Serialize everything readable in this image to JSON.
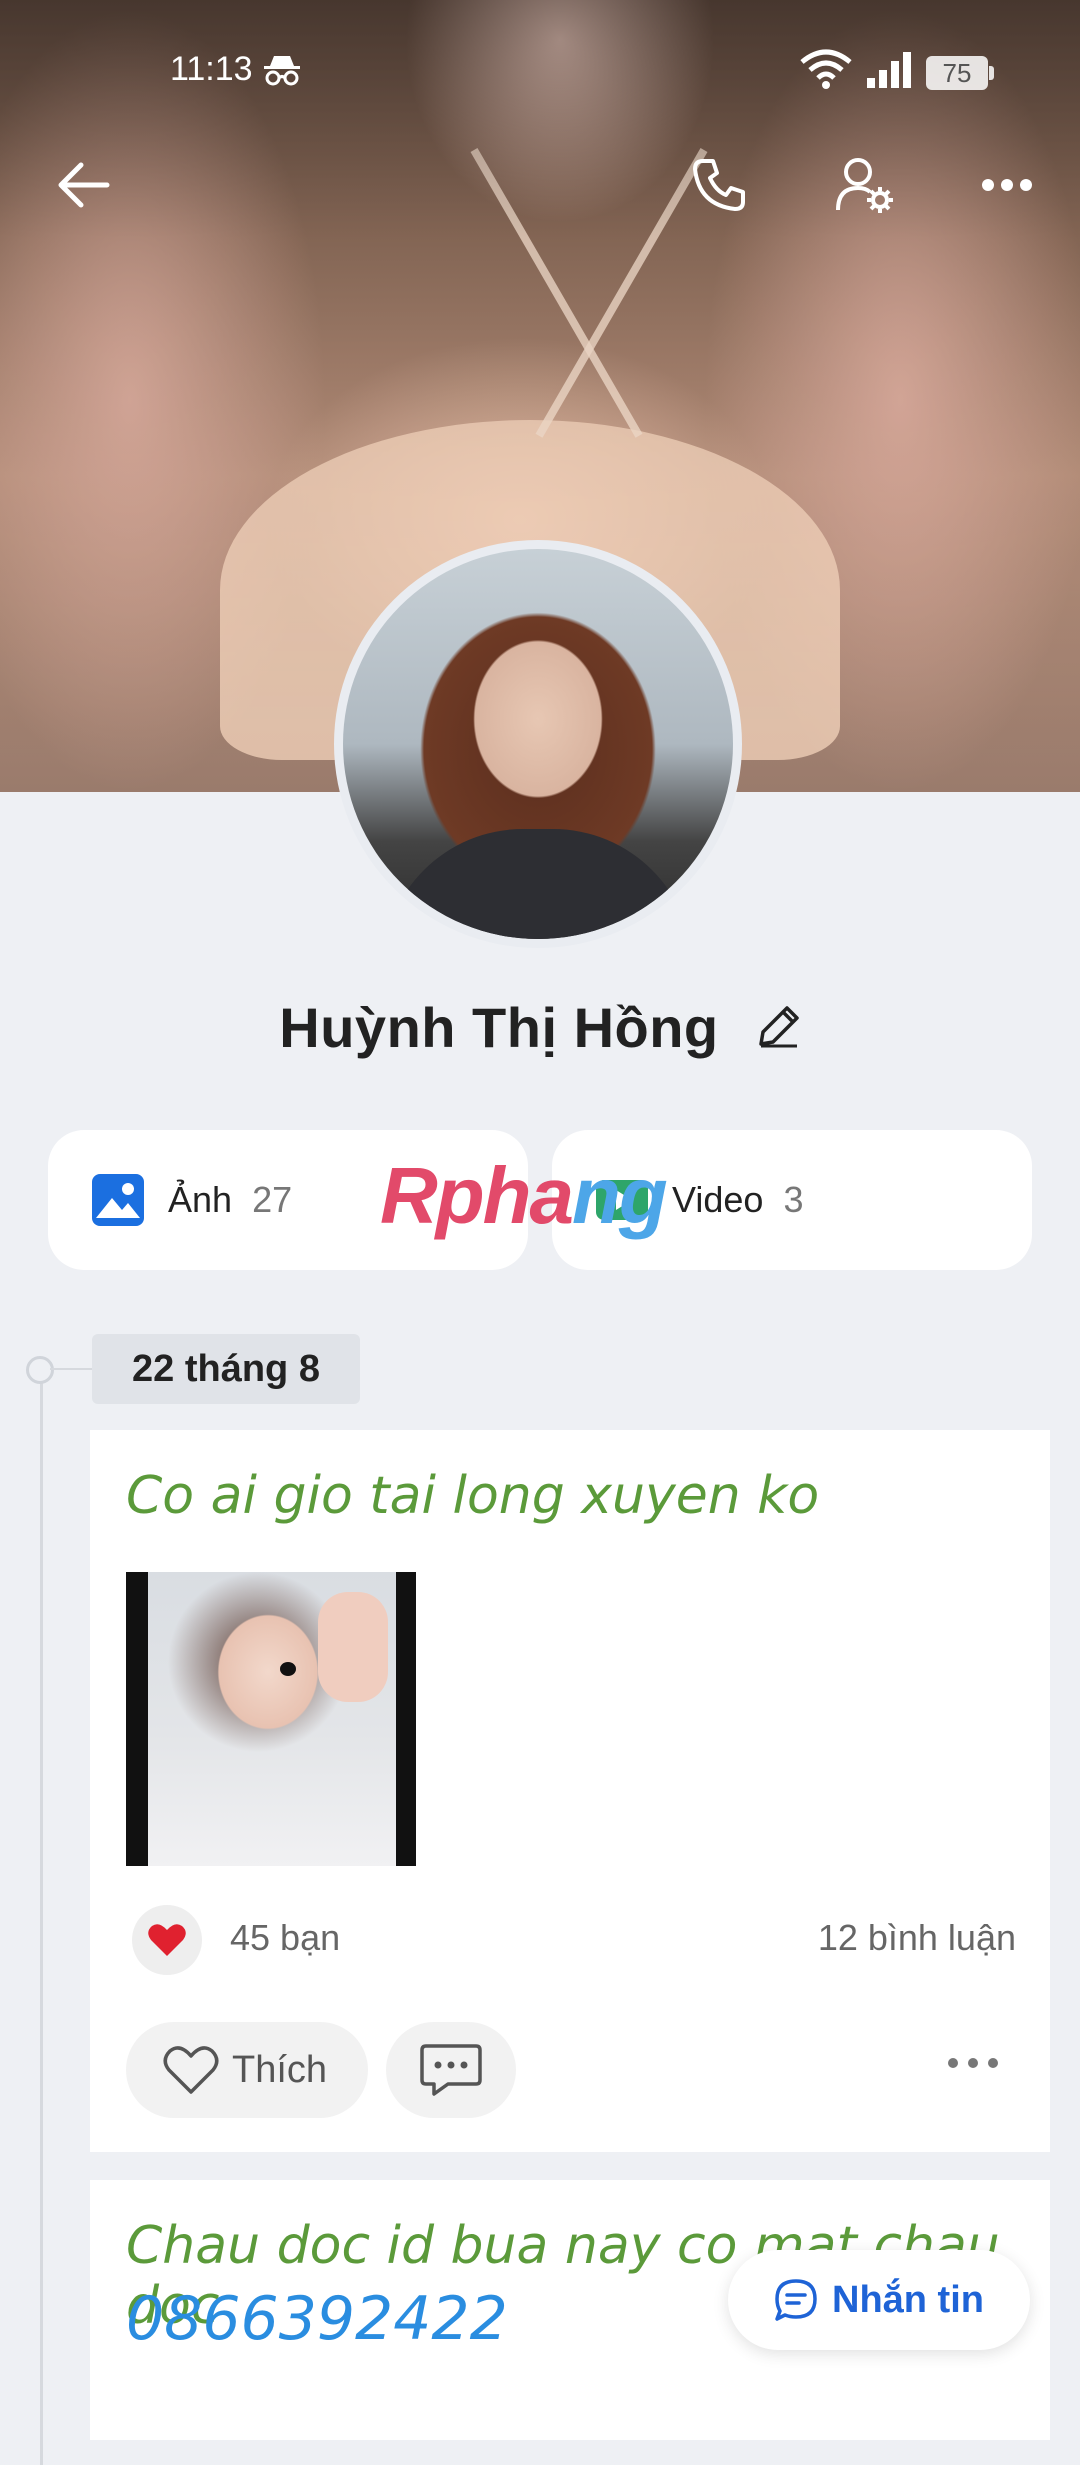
{
  "status_bar": {
    "time": "11:13",
    "battery": "75"
  },
  "profile": {
    "name": "Huỳnh Thị Hồng"
  },
  "media": {
    "photos_label": "Ảnh",
    "photos_count": "27",
    "videos_label": "Video",
    "videos_count": "3"
  },
  "watermark": {
    "part1": "Rpha",
    "part2": "ng"
  },
  "timeline": {
    "date": "22 tháng 8"
  },
  "posts": [
    {
      "text": "Co ai gio tai long xuyen ko",
      "reactions_friends": "45 bạn",
      "comments": "12 bình luận",
      "like_label": "Thích"
    },
    {
      "text": "Chau doc id bua nay co mat chau doc",
      "phone": "0866392422"
    }
  ],
  "message_button": {
    "label": "Nhắn tin"
  },
  "colors": {
    "accent": "#1e63d6",
    "post_text": "#5b9a3a",
    "phone_text": "#2a8de0"
  }
}
